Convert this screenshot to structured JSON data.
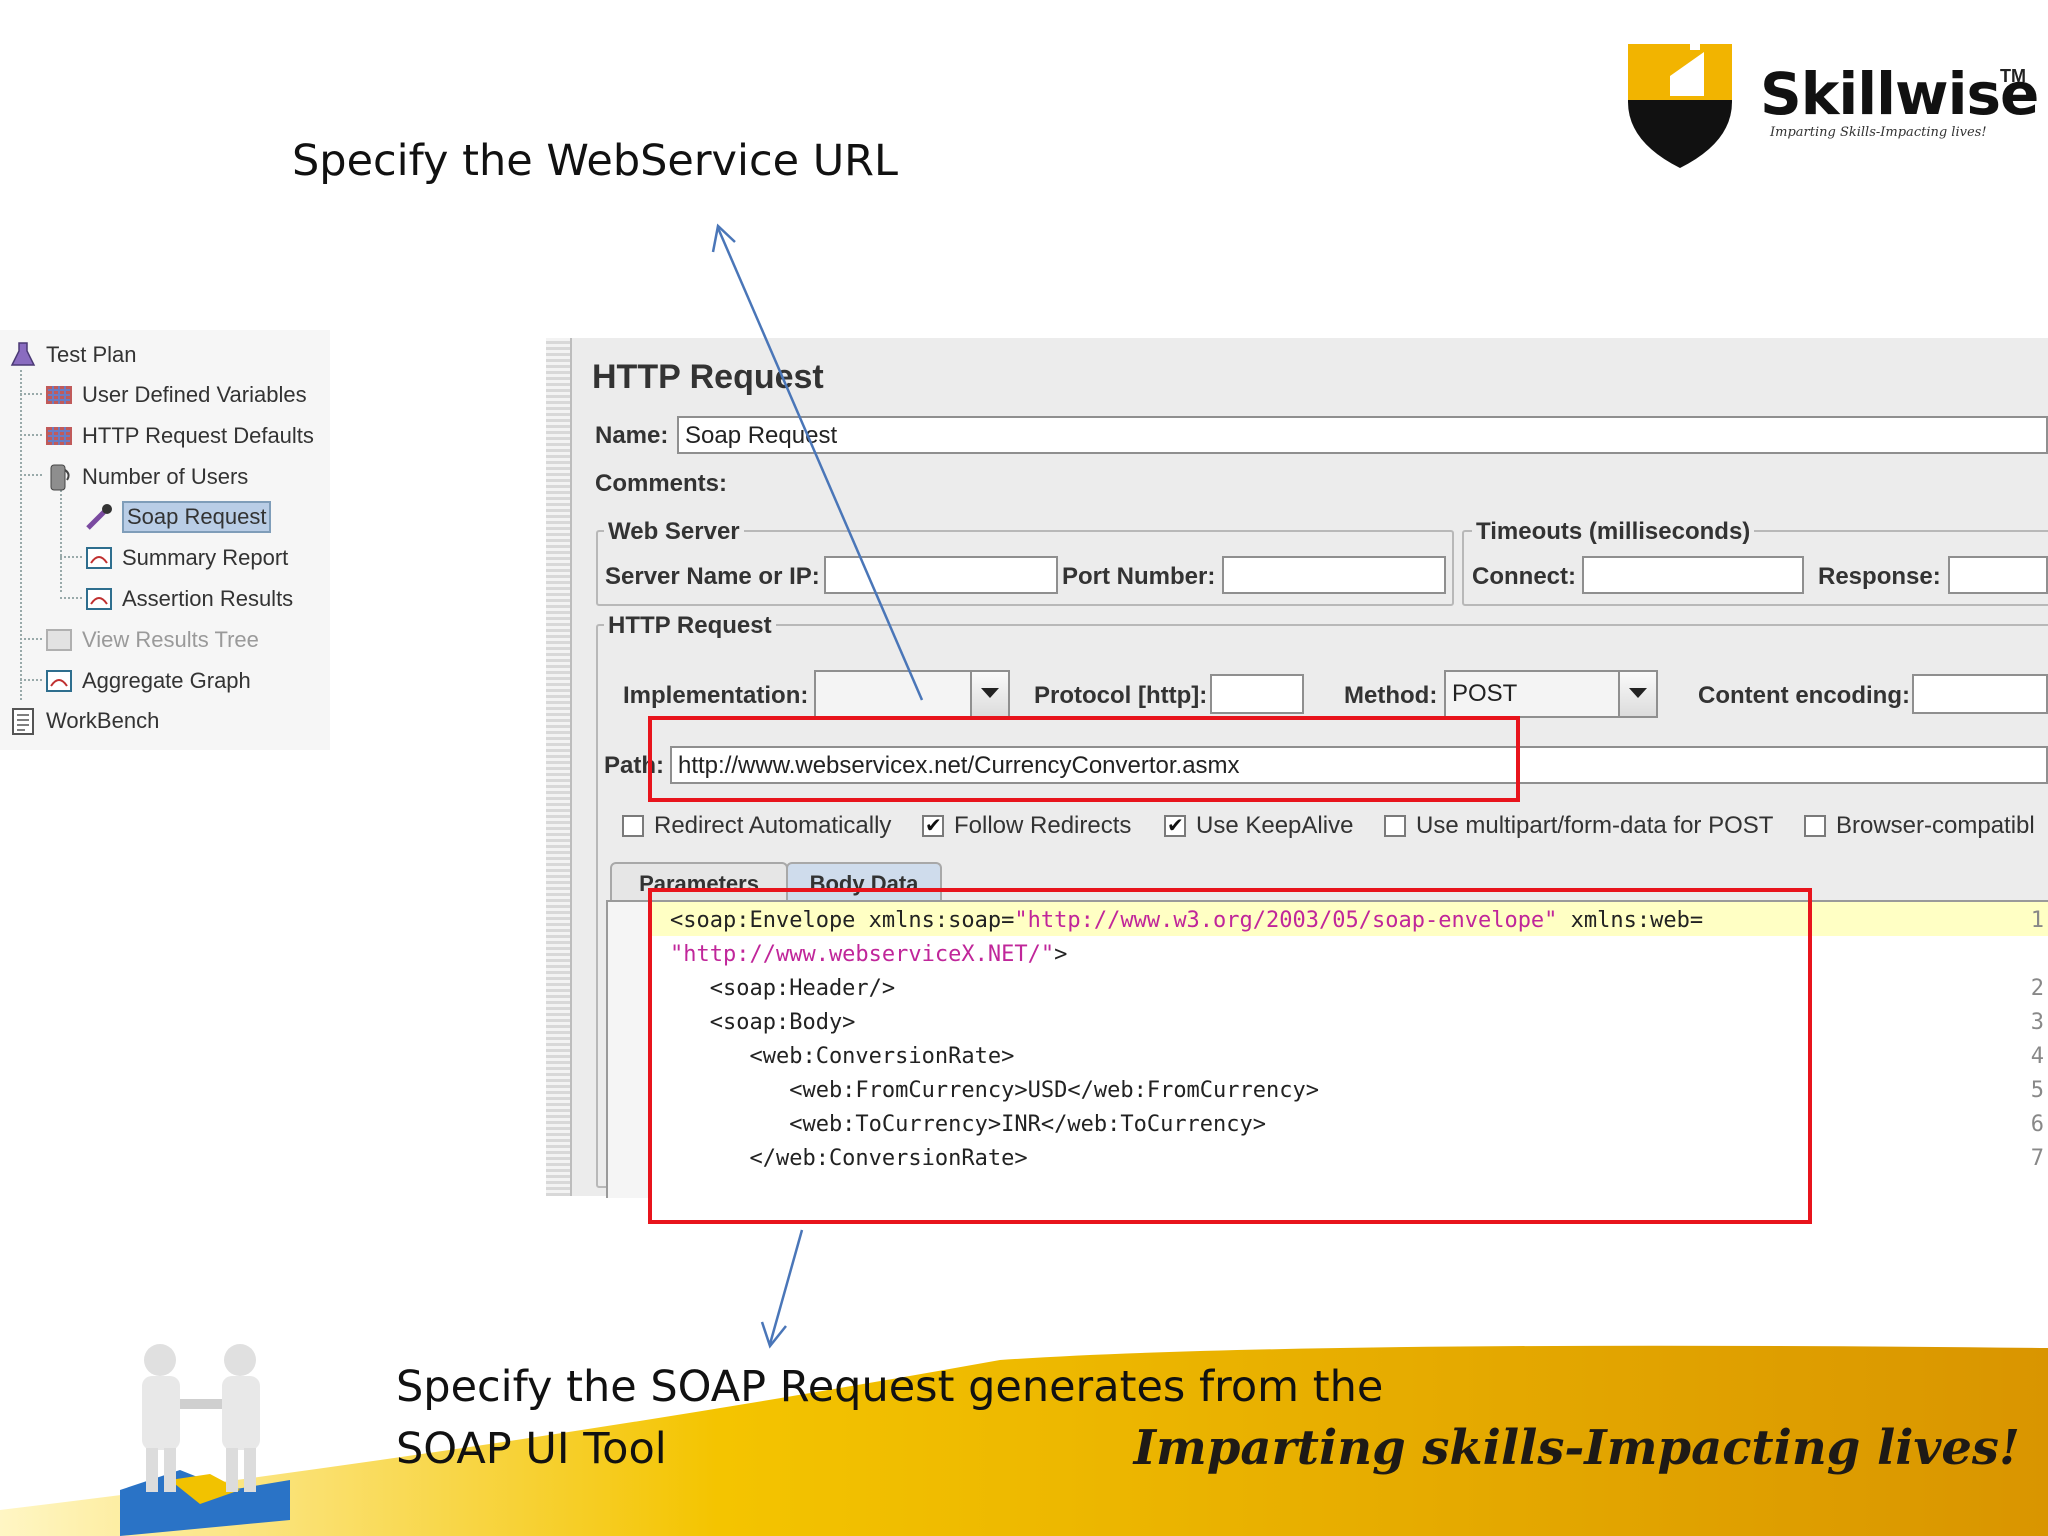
{
  "slide": {
    "caption_top": "Specify the WebService URL",
    "caption_bottom_line1": "Specify the SOAP Request generates from the",
    "caption_bottom_line2": "SOAP UI Tool",
    "footer_tagline": "Imparting skills-Impacting lives!"
  },
  "logo": {
    "name": "Skillwise",
    "tm": "TM",
    "tagline": "Imparting Skills-Impacting lives!"
  },
  "tree": {
    "items": [
      {
        "label": "Test Plan",
        "icon": "flask-icon"
      },
      {
        "label": "User Defined Variables",
        "icon": "config-element-icon"
      },
      {
        "label": "HTTP Request Defaults",
        "icon": "config-element-icon"
      },
      {
        "label": "Number of Users",
        "icon": "thread-group-icon"
      },
      {
        "label": "Soap Request",
        "icon": "sampler-pipette-icon"
      },
      {
        "label": "Summary Report",
        "icon": "listener-icon"
      },
      {
        "label": "Assertion Results",
        "icon": "listener-icon"
      },
      {
        "label": "View Results Tree",
        "icon": "listener-disabled-icon"
      },
      {
        "label": "Aggregate Graph",
        "icon": "listener-icon"
      },
      {
        "label": "WorkBench",
        "icon": "workbench-icon"
      }
    ]
  },
  "request": {
    "title": "HTTP Request",
    "name_label": "Name:",
    "name_value": "Soap Request",
    "comments_label": "Comments:",
    "web_server": {
      "legend": "Web Server",
      "server_label": "Server Name or IP:",
      "server_value": "",
      "port_label": "Port Number:",
      "port_value": ""
    },
    "timeouts": {
      "legend": "Timeouts (milliseconds)",
      "connect_label": "Connect:",
      "response_label": "Response:"
    },
    "http": {
      "legend": "HTTP Request",
      "implementation_label": "Implementation:",
      "implementation_value": "",
      "protocol_label": "Protocol [http]:",
      "protocol_value": "",
      "method_label": "Method:",
      "method_value": "POST",
      "encoding_label": "Content encoding:",
      "path_label": "Path:",
      "path_value": "http://www.webservicex.net/CurrencyConvertor.asmx"
    },
    "checkboxes": [
      {
        "label": "Redirect Automatically",
        "checked": false
      },
      {
        "label": "Follow Redirects",
        "checked": true
      },
      {
        "label": "Use KeepAlive",
        "checked": true
      },
      {
        "label": "Use multipart/form-data for POST",
        "checked": false
      },
      {
        "label": "Browser-compatibl",
        "checked": false
      }
    ],
    "tabs": [
      "Parameters",
      "Body Data"
    ],
    "active_tab": "Body Data",
    "body_lines": [
      {
        "n": "1",
        "parts": [
          [
            "<soap:Envelope xmlns:soap=",
            "t"
          ],
          [
            "\"http://www.w3.org/2003/05/soap-envelope\"",
            "s"
          ],
          [
            " xmlns:web=",
            "t"
          ]
        ]
      },
      {
        "n": "",
        "parts": [
          [
            "\"http://www.webserviceX.NET/\"",
            "s"
          ],
          [
            ">",
            "t"
          ]
        ]
      },
      {
        "n": "2",
        "parts": [
          [
            "   <soap:Header/>",
            "t"
          ]
        ]
      },
      {
        "n": "3",
        "parts": [
          [
            "   <soap:Body>",
            "t"
          ]
        ]
      },
      {
        "n": "4",
        "parts": [
          [
            "      <web:ConversionRate>",
            "t"
          ]
        ]
      },
      {
        "n": "5",
        "parts": [
          [
            "         <web:FromCurrency>USD</web:FromCurrency>",
            "t"
          ]
        ]
      },
      {
        "n": "6",
        "parts": [
          [
            "         <web:ToCurrency>INR</web:ToCurrency>",
            "t"
          ]
        ]
      },
      {
        "n": "7",
        "parts": [
          [
            "      </web:ConversionRate>",
            "t"
          ]
        ]
      }
    ]
  },
  "colors": {
    "highlight_red": "#e8141c",
    "arrow_blue": "#4a76b8",
    "footer_gold": "#f2b400",
    "string_magenta": "#c0269a"
  }
}
